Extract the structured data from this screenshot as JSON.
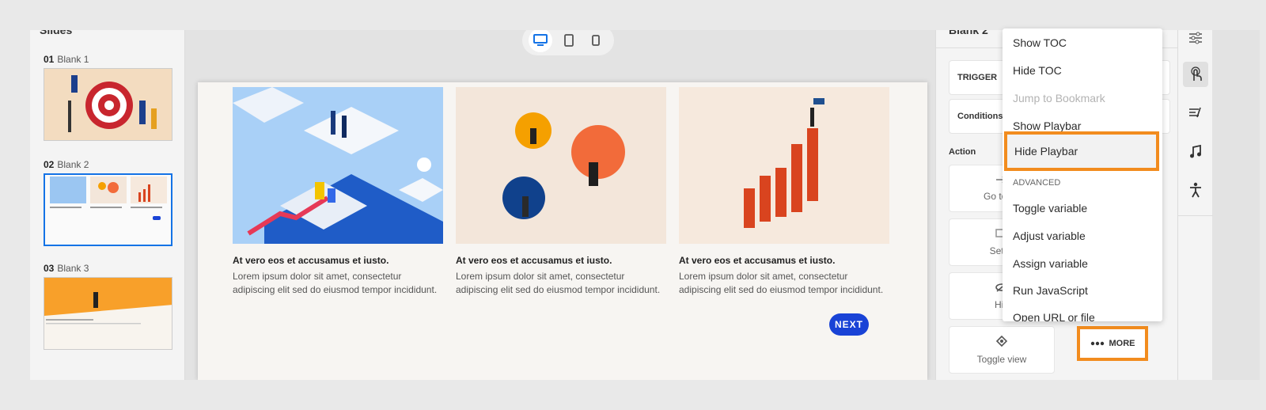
{
  "slides_panel": {
    "title": "Slides",
    "items": [
      {
        "number": "01",
        "label": "Blank 1"
      },
      {
        "number": "02",
        "label": "Blank 2"
      },
      {
        "number": "03",
        "label": "Blank 3"
      }
    ]
  },
  "device_toggle": {
    "options": [
      "desktop-icon",
      "tablet-icon",
      "mobile-icon"
    ],
    "active": "desktop"
  },
  "slide": {
    "cards": [
      {
        "title": "At vero eos et accusamus et iusto.",
        "text": "Lorem ipsum dolor sit amet, consectetur adipiscing elit sed do eiusmod tempor incididunt."
      },
      {
        "title": "At vero eos et accusamus et iusto.",
        "text": "Lorem ipsum dolor sit amet, consectetur adipiscing elit sed do eiusmod tempor incididunt."
      },
      {
        "title": "At vero eos et accusamus et iusto.",
        "text": "Lorem ipsum dolor sit amet, consectetur adipiscing elit sed do eiusmod tempor incididunt."
      }
    ],
    "next_label": "NEXT",
    "accent": "#1943d6"
  },
  "properties": {
    "title": "Blank 2",
    "trigger_label": "TRIGGER",
    "conditions_label": "Conditions",
    "action_label": "Action",
    "tiles": [
      {
        "label": "Go to ne"
      },
      {
        "label": "Set st"
      },
      {
        "label": "Hid"
      },
      {
        "label": "Toggle view"
      }
    ],
    "more_label": "MORE"
  },
  "menu": {
    "items_top": [
      {
        "label": "Show TOC"
      },
      {
        "label": "Hide TOC"
      },
      {
        "label": "Jump to Bookmark",
        "disabled": true
      },
      {
        "label": "Show Playbar"
      },
      {
        "label": "Hide Playbar",
        "highlighted": true
      }
    ],
    "section_label": "ADVANCED",
    "items_advanced": [
      {
        "label": "Toggle variable"
      },
      {
        "label": "Adjust variable"
      },
      {
        "label": "Assign variable"
      },
      {
        "label": "Run JavaScript"
      },
      {
        "label": "Open URL or file"
      }
    ],
    "highlight_color": "#f28c1e"
  },
  "rail": {
    "icons": [
      "sliders-icon",
      "interaction-icon",
      "effects-icon",
      "audio-icon",
      "accessibility-icon"
    ],
    "active": "interaction-icon"
  }
}
